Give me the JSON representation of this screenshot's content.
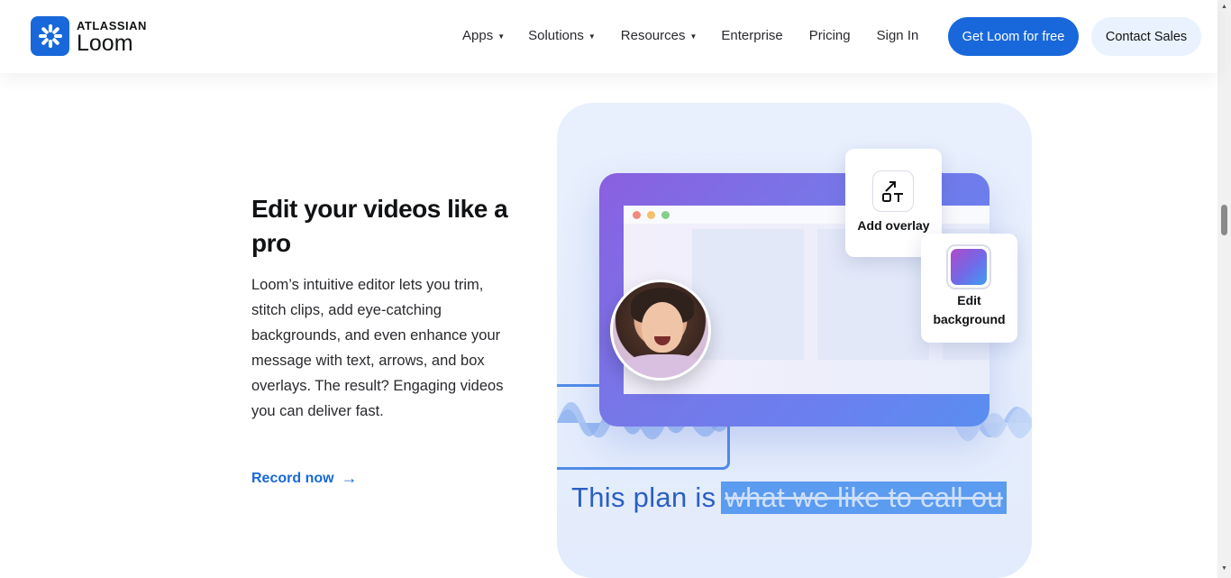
{
  "header": {
    "logo": {
      "brand": "ATLASSIAN",
      "product": "Loom",
      "icon": "loom-burst-icon"
    },
    "nav": [
      {
        "label": "Apps",
        "has_dropdown": true
      },
      {
        "label": "Solutions",
        "has_dropdown": true
      },
      {
        "label": "Resources",
        "has_dropdown": true
      },
      {
        "label": "Enterprise",
        "has_dropdown": false
      },
      {
        "label": "Pricing",
        "has_dropdown": false
      },
      {
        "label": "Sign In",
        "has_dropdown": false
      }
    ],
    "caret": "▼",
    "cta_primary": "Get Loom for free",
    "cta_secondary": "Contact Sales"
  },
  "feature": {
    "heading": "Edit your videos like a pro",
    "body": "Loom’s intuitive editor lets you trim, stitch clips, add eye-catching backgrounds, and even enhance your message with text, arrows, and box overlays. The result? Engaging videos you can deliver fast.",
    "link_label": "Record now",
    "link_arrow": "→"
  },
  "illustration": {
    "overlay_card_label": "Add overlay",
    "background_card_label": "Edit background",
    "caption_plain": "This plan is",
    "caption_highlighted": "what we like to call ou"
  },
  "colors": {
    "brand": "#1868db",
    "accent_light": "#e9f2fe"
  }
}
